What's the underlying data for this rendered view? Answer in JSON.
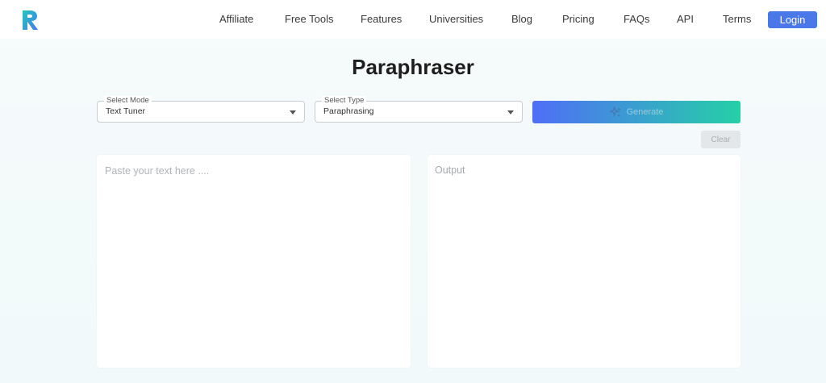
{
  "brand": {
    "accent": "#4f6ef7",
    "accent_end": "#25d0a6"
  },
  "nav": {
    "items": [
      "Affiliate",
      "Free Tools",
      "Features",
      "Universities",
      "Blog",
      "Pricing",
      "FAQs",
      "API",
      "Terms"
    ],
    "login_label": "Login",
    "login_color": "#4a78e8"
  },
  "page": {
    "title": "Paraphraser"
  },
  "controls": {
    "mode": {
      "label": "Select Mode",
      "value": "Text Tuner"
    },
    "type": {
      "label": "Select Type",
      "value": "Paraphrasing"
    },
    "generate_label": "Generate",
    "clear_label": "Clear"
  },
  "editor": {
    "input_placeholder": "Paste your text here ....",
    "output_placeholder": "Output"
  }
}
